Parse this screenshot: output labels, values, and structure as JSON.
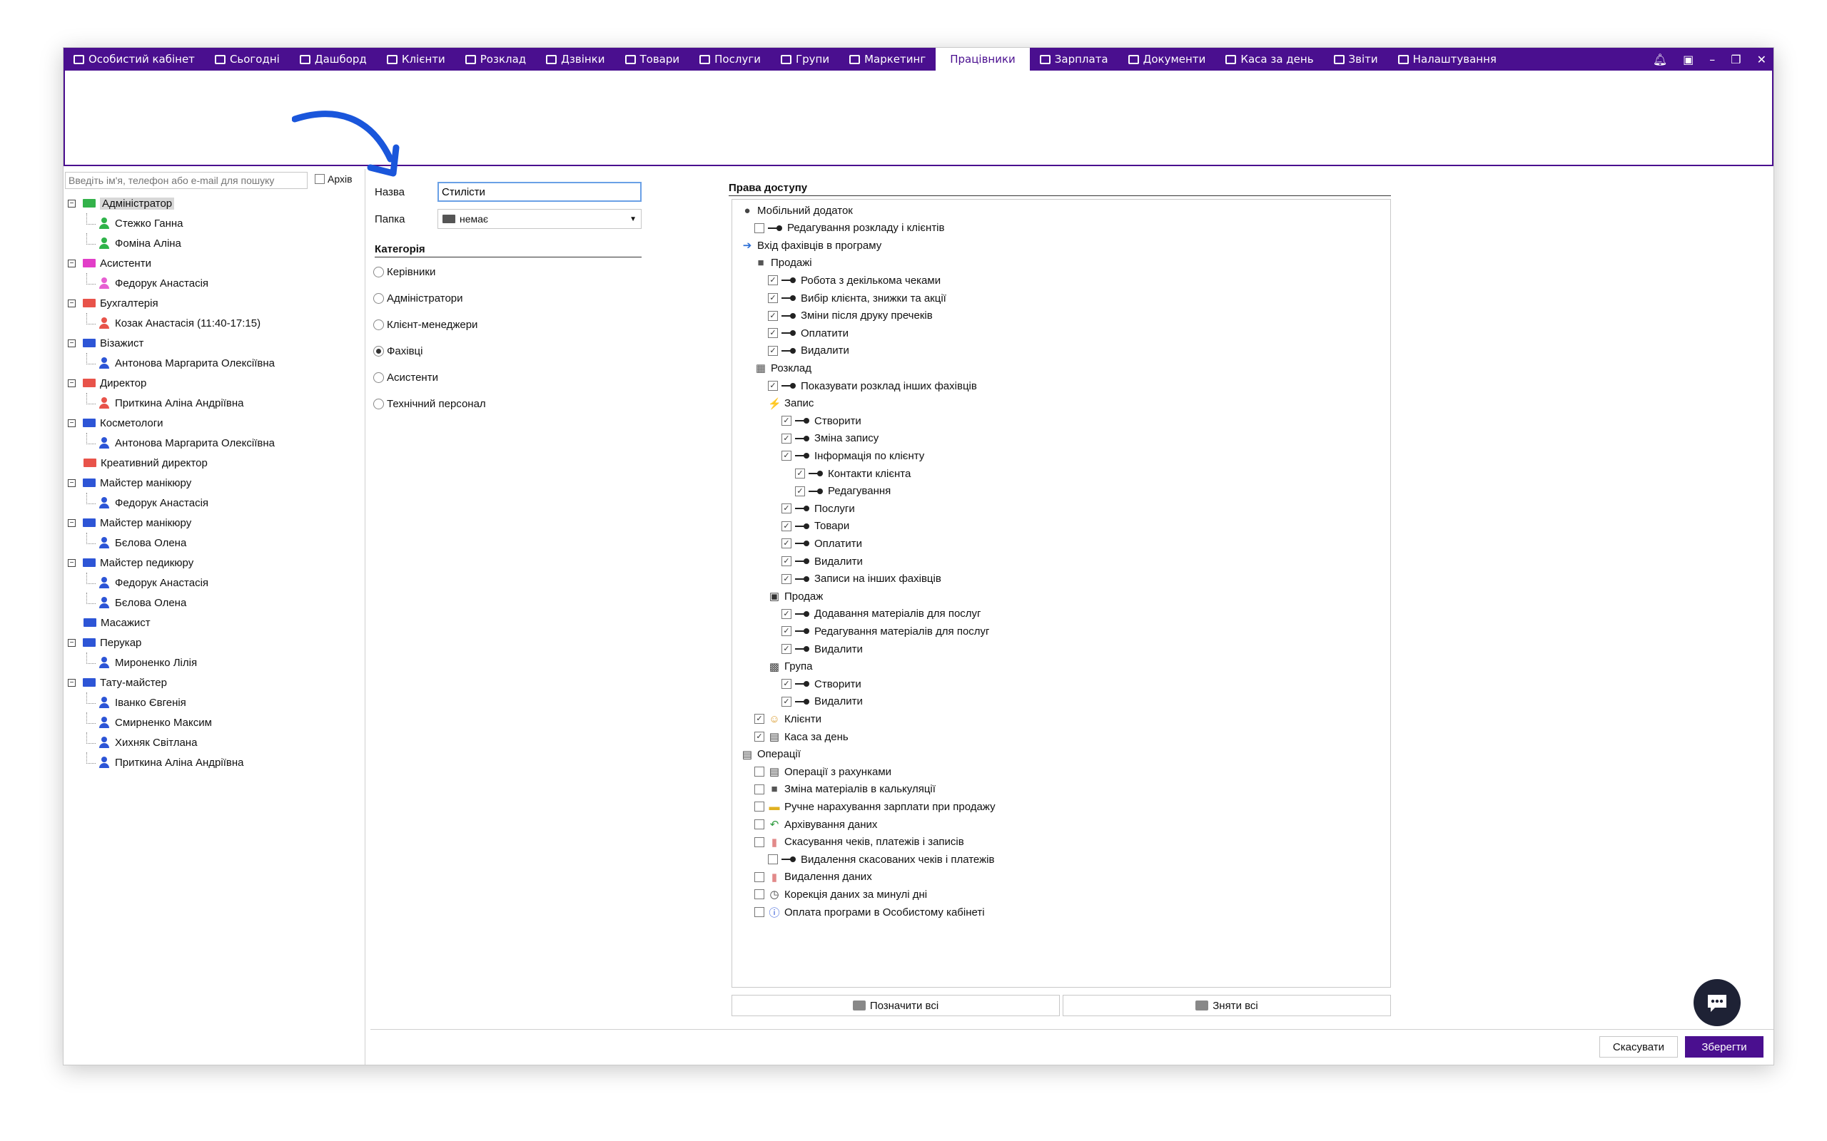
{
  "nav": {
    "tabs": [
      {
        "label": "Особистий кабінет",
        "icon": "folder-icon"
      },
      {
        "label": "Сьогодні",
        "icon": "circle-icon"
      },
      {
        "label": "Дашборд",
        "icon": "pulse-icon"
      },
      {
        "label": "Клієнти",
        "icon": "user-circle-icon"
      },
      {
        "label": "Розклад",
        "icon": "calendar-icon"
      },
      {
        "label": "Дзвінки",
        "icon": "phone-icon"
      },
      {
        "label": "Товари",
        "icon": "box-icon"
      },
      {
        "label": "Послуги",
        "icon": "lightning-icon"
      },
      {
        "label": "Групи",
        "icon": "group-icon"
      },
      {
        "label": "Маркетинг",
        "icon": "megaphone-icon"
      },
      {
        "label": "Працівники",
        "icon": "employee-icon",
        "active": true
      },
      {
        "label": "Зарплата",
        "icon": "money-icon"
      },
      {
        "label": "Документи",
        "icon": "document-icon"
      },
      {
        "label": "Каса за день",
        "icon": "calculator-icon"
      },
      {
        "label": "Звіти",
        "icon": "bar-chart-icon"
      },
      {
        "label": "Налаштування",
        "icon": "gear-icon"
      }
    ]
  },
  "left": {
    "search_placeholder": "Введіть ім'я, телефон або e-mail для пошуку",
    "archive_label": "Архів",
    "tree": [
      {
        "type": "group",
        "label": "Адміністратор",
        "color": "#33b24a",
        "expanded": true,
        "selected": true
      },
      {
        "type": "emp",
        "label": "Стежко Ганна",
        "color": "#2fb34a"
      },
      {
        "type": "emp",
        "label": "Фоміна Аліна",
        "color": "#2fb34a"
      },
      {
        "type": "group",
        "label": "Асистенти",
        "color": "#e23ec8",
        "expanded": true
      },
      {
        "type": "emp",
        "label": "Федорук Анастасія",
        "color": "#e75fd2"
      },
      {
        "type": "group",
        "label": "Бухгалтерія",
        "color": "#e8534a",
        "expanded": true
      },
      {
        "type": "emp",
        "label": "Козак Анастасія (11:40-17:15)",
        "color": "#e8534a"
      },
      {
        "type": "group",
        "label": "Візажист",
        "color": "#2d55d6",
        "expanded": true
      },
      {
        "type": "emp",
        "label": "Антонова Маргарита Олексіївна",
        "color": "#2d55d6"
      },
      {
        "type": "group",
        "label": "Директор",
        "color": "#e8534a",
        "expanded": true
      },
      {
        "type": "emp",
        "label": "Приткина Аліна Андріївна",
        "color": "#e8534a"
      },
      {
        "type": "group",
        "label": "Косметологи",
        "color": "#2d55d6",
        "expanded": true
      },
      {
        "type": "emp",
        "label": "Антонова Маргарита Олексіївна",
        "color": "#2d55d6"
      },
      {
        "type": "group",
        "label": "Креативний директор",
        "color": "#e8534a",
        "expanded": false
      },
      {
        "type": "group",
        "label": "Майстер манікюру",
        "color": "#2d55d6",
        "expanded": true
      },
      {
        "type": "emp",
        "label": "Федорук Анастасія",
        "color": "#2d55d6"
      },
      {
        "type": "group",
        "label": "Майстер манікюру",
        "color": "#2d55d6",
        "expanded": true
      },
      {
        "type": "emp",
        "label": "Бєлова Олена",
        "color": "#2d55d6"
      },
      {
        "type": "group",
        "label": "Майстер педикюру",
        "color": "#2d55d6",
        "expanded": true
      },
      {
        "type": "emp",
        "label": "Федорук Анастасія",
        "color": "#2d55d6"
      },
      {
        "type": "emp",
        "label": "Бєлова Олена",
        "color": "#2d55d6"
      },
      {
        "type": "group",
        "label": "Масажист",
        "color": "#2d55d6",
        "expanded": false
      },
      {
        "type": "group",
        "label": "Перукар",
        "color": "#2d55d6",
        "expanded": true
      },
      {
        "type": "emp",
        "label": "Мироненко Лілія",
        "color": "#2d55d6"
      },
      {
        "type": "group",
        "label": "Тату-майстер",
        "color": "#2d55d6",
        "expanded": true
      },
      {
        "type": "emp",
        "label": "Іванко Євгенія",
        "color": "#2d55d6"
      },
      {
        "type": "emp",
        "label": "Смирненко Максим",
        "color": "#2d55d6"
      },
      {
        "type": "emp",
        "label": "Хихняк Світлана",
        "color": "#2d55d6"
      },
      {
        "type": "emp",
        "label": "Приткина Аліна Андріївна",
        "color": "#2d55d6"
      }
    ]
  },
  "form": {
    "name_label": "Назва",
    "name_value": "Стилісти",
    "folder_label": "Папка",
    "folder_value": "немає",
    "category_title": "Категорія",
    "categories": [
      {
        "label": "Керівники",
        "checked": false
      },
      {
        "label": "Адміністратори",
        "checked": false
      },
      {
        "label": "Клієнт-менеджери",
        "checked": false
      },
      {
        "label": "Фахівці",
        "checked": true
      },
      {
        "label": "Асистенти",
        "checked": false
      },
      {
        "label": "Технічний персонал",
        "checked": false
      }
    ]
  },
  "rights": {
    "title": "Права доступу",
    "items": [
      {
        "label": "Мобільний додаток",
        "level": 0,
        "cb": null,
        "icon": "chat-bubble-icon"
      },
      {
        "label": "Редагування розкладу і клієнтів",
        "level": 1,
        "cb": false,
        "icon": "key-icon"
      },
      {
        "label": "Вхід фахівців в програму",
        "level": 0,
        "cb": null,
        "icon": "arrow-right-icon"
      },
      {
        "label": "Продажі",
        "level": 1,
        "cb": null,
        "icon": "box-icon"
      },
      {
        "label": "Робота з декількома чеками",
        "level": 2,
        "cb": true,
        "icon": "key-icon"
      },
      {
        "label": "Вибір клієнта, знижки та акції",
        "level": 2,
        "cb": true,
        "icon": "key-icon"
      },
      {
        "label": "Зміни після друку пречеків",
        "level": 2,
        "cb": true,
        "icon": "key-icon"
      },
      {
        "label": "Оплатити",
        "level": 2,
        "cb": true,
        "icon": "key-icon"
      },
      {
        "label": "Видалити",
        "level": 2,
        "cb": true,
        "icon": "key-icon"
      },
      {
        "label": "Розклад",
        "level": 1,
        "cb": null,
        "icon": "calendar-icon"
      },
      {
        "label": "Показувати розклад інших фахівців",
        "level": 2,
        "cb": true,
        "icon": "key-icon"
      },
      {
        "label": "Запис",
        "level": 2,
        "cb": null,
        "icon": "lightning-icon"
      },
      {
        "label": "Створити",
        "level": 3,
        "cb": true,
        "icon": "key-icon"
      },
      {
        "label": "Зміна запису",
        "level": 3,
        "cb": true,
        "icon": "key-icon"
      },
      {
        "label": "Інформація по клієнту",
        "level": 3,
        "cb": true,
        "icon": "key-icon"
      },
      {
        "label": "Контакти клієнта",
        "level": 4,
        "cb": true,
        "icon": "key-icon"
      },
      {
        "label": "Редагування",
        "level": 4,
        "cb": true,
        "icon": "key-icon"
      },
      {
        "label": "Послуги",
        "level": 3,
        "cb": true,
        "icon": "key-icon"
      },
      {
        "label": "Товари",
        "level": 3,
        "cb": true,
        "icon": "key-icon"
      },
      {
        "label": "Оплатити",
        "level": 3,
        "cb": true,
        "icon": "key-icon"
      },
      {
        "label": "Видалити",
        "level": 3,
        "cb": true,
        "icon": "key-icon"
      },
      {
        "label": "Записи на інших фахівців",
        "level": 3,
        "cb": true,
        "icon": "key-icon"
      },
      {
        "label": "Продаж",
        "level": 2,
        "cb": null,
        "icon": "money-icon"
      },
      {
        "label": "Додавання матеріалів для послуг",
        "level": 3,
        "cb": true,
        "icon": "key-icon"
      },
      {
        "label": "Редагування матеріалів для послуг",
        "level": 3,
        "cb": true,
        "icon": "key-icon"
      },
      {
        "label": "Видалити",
        "level": 3,
        "cb": true,
        "icon": "key-icon"
      },
      {
        "label": "Група",
        "level": 2,
        "cb": null,
        "icon": "group-icon"
      },
      {
        "label": "Створити",
        "level": 3,
        "cb": true,
        "icon": "key-icon"
      },
      {
        "label": "Видалити",
        "level": 3,
        "cb": true,
        "icon": "key-icon"
      },
      {
        "label": "Клієнти",
        "level": 1,
        "cb": true,
        "icon": "clients-icon"
      },
      {
        "label": "Каса за день",
        "level": 1,
        "cb": true,
        "icon": "calculator-icon"
      },
      {
        "label": "Операції",
        "level": 0,
        "cb": null,
        "icon": "calculator-icon"
      },
      {
        "label": "Операції з рахунками",
        "level": 1,
        "cb": false,
        "icon": "calculator-icon"
      },
      {
        "label": "Зміна матеріалів в калькуляції",
        "level": 1,
        "cb": false,
        "icon": "box-icon"
      },
      {
        "label": "Ручне нарахування зарплати при продажу",
        "level": 1,
        "cb": false,
        "icon": "wallet-icon"
      },
      {
        "label": "Архівування даних",
        "level": 1,
        "cb": false,
        "icon": "archive-arrow-icon"
      },
      {
        "label": "Скасування чеків, платежів і записів",
        "level": 1,
        "cb": false,
        "icon": "trash-icon"
      },
      {
        "label": "Видалення скасованих чеків і платежів",
        "level": 2,
        "cb": false,
        "icon": "key-icon"
      },
      {
        "label": "Видалення даних",
        "level": 1,
        "cb": false,
        "icon": "trash-icon"
      },
      {
        "label": "Корекція даних за минулі дні",
        "level": 1,
        "cb": false,
        "icon": "clock-icon"
      },
      {
        "label": "Оплата програми в Особистому кабінеті",
        "level": 1,
        "cb": false,
        "icon": "info-icon"
      }
    ],
    "select_all": "Позначити всі",
    "deselect_all": "Зняти всі"
  },
  "footer": {
    "cancel": "Скасувати",
    "save": "Зберегти"
  },
  "colors": {
    "accent": "#4a0f8f"
  }
}
